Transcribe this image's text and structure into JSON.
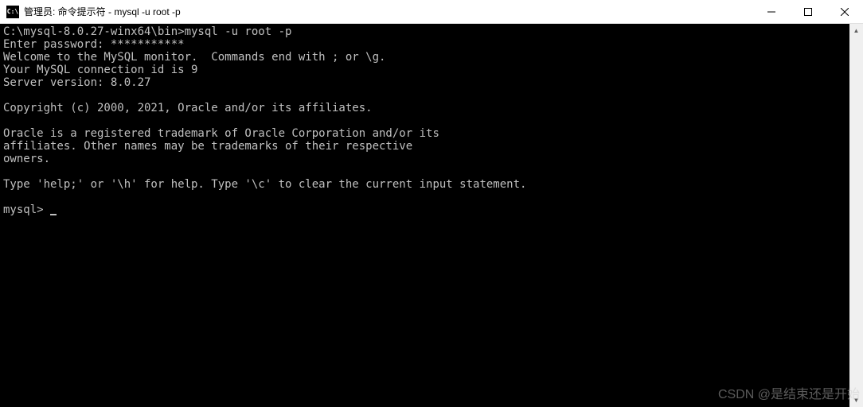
{
  "titlebar": {
    "icon_text": "C:\\",
    "title": "管理员: 命令提示符 - mysql  -u root -p"
  },
  "terminal": {
    "lines": [
      "C:\\mysql-8.0.27-winx64\\bin>mysql -u root -p",
      "Enter password: ***********",
      "Welcome to the MySQL monitor.  Commands end with ; or \\g.",
      "Your MySQL connection id is 9",
      "Server version: 8.0.27",
      "",
      "Copyright (c) 2000, 2021, Oracle and/or its affiliates.",
      "",
      "Oracle is a registered trademark of Oracle Corporation and/or its",
      "affiliates. Other names may be trademarks of their respective",
      "owners.",
      "",
      "Type 'help;' or '\\h' for help. Type '\\c' to clear the current input statement.",
      ""
    ],
    "prompt": "mysql> "
  },
  "watermark": "CSDN @是结束还是开始"
}
